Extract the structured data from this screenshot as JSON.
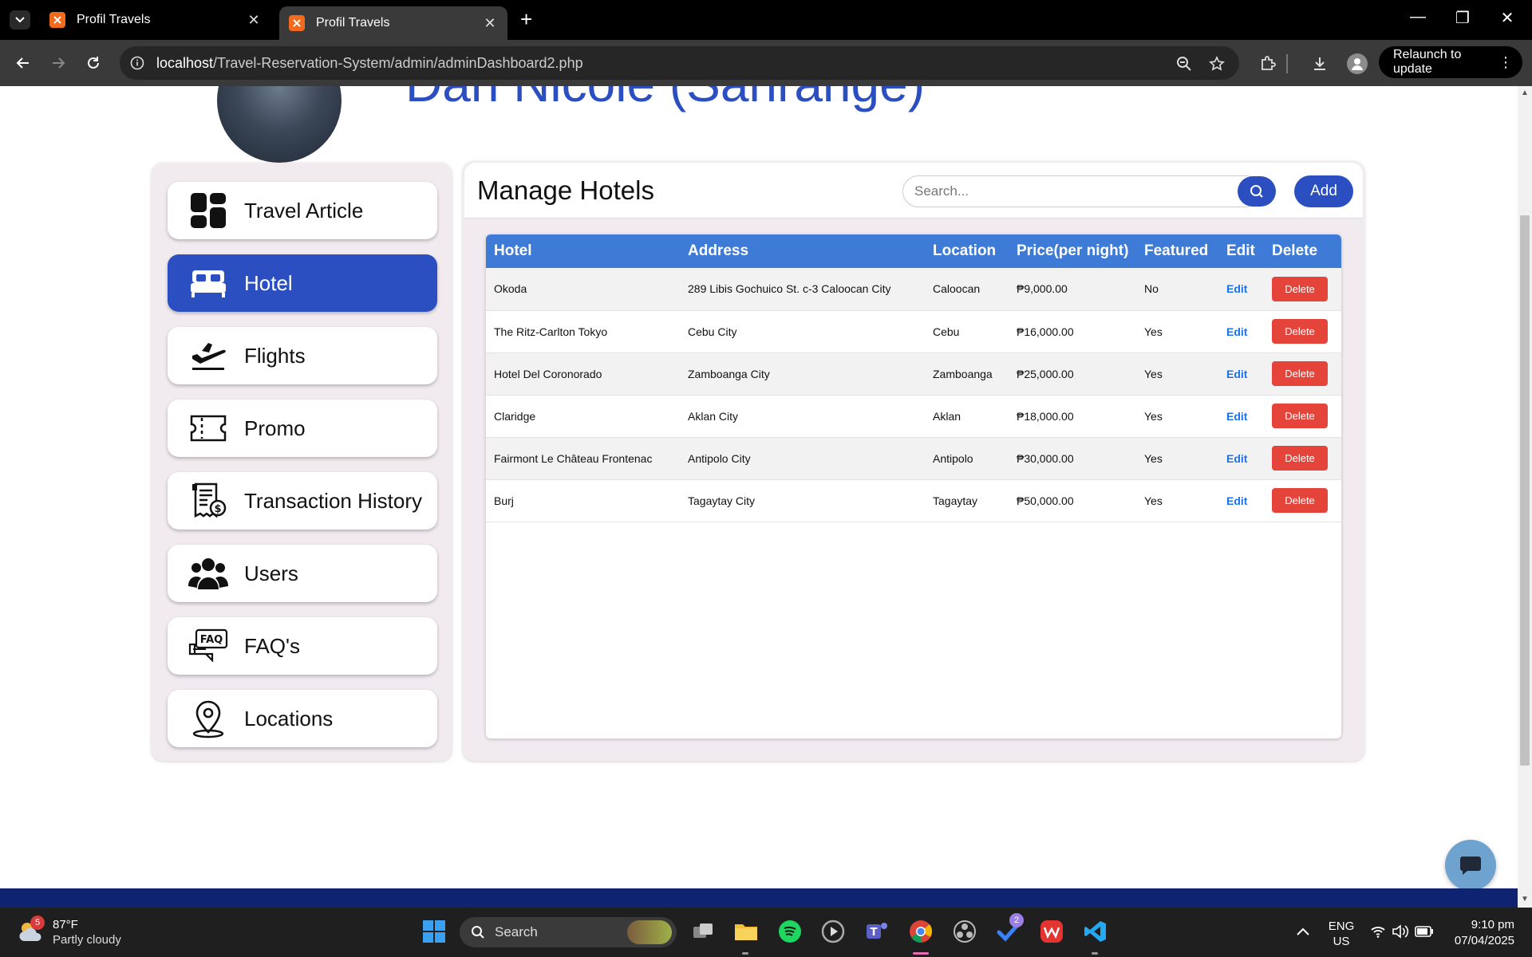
{
  "browser": {
    "tabs": [
      {
        "title": "Profil Travels",
        "active": false
      },
      {
        "title": "Profil Travels",
        "active": true
      }
    ],
    "new_tab_icon": "plus-icon",
    "url_host": "localhost",
    "url_path": "/Travel-Reservation-System/admin/adminDashboard2.php",
    "relaunch_label": "Relaunch to update"
  },
  "profile": {
    "name": "Dan Nicole (Sanrange)"
  },
  "sidebar": {
    "items": [
      {
        "label": "Travel Article",
        "icon": "dashboard-icon",
        "active": false
      },
      {
        "label": "Hotel",
        "icon": "bed-icon",
        "active": true
      },
      {
        "label": "Flights",
        "icon": "plane-departure-icon",
        "active": false
      },
      {
        "label": "Promo",
        "icon": "ticket-icon",
        "active": false
      },
      {
        "label": "Transaction History",
        "icon": "receipt-icon",
        "active": false
      },
      {
        "label": "Users",
        "icon": "users-icon",
        "active": false
      },
      {
        "label": "FAQ's",
        "icon": "faq-icon",
        "active": false
      },
      {
        "label": "Locations",
        "icon": "location-pin-icon",
        "active": false
      }
    ]
  },
  "main": {
    "title": "Manage Hotels",
    "search_placeholder": "Search...",
    "add_label": "Add",
    "columns": [
      "Hotel",
      "Address",
      "Location",
      "Price(per night)",
      "Featured",
      "Edit",
      "Delete"
    ],
    "rows": [
      {
        "hotel": "Okoda",
        "address": "289 Libis Gochuico St. c-3 Caloocan City",
        "location": "Caloocan",
        "price": "₱9,000.00",
        "featured": "No",
        "edit": "Edit",
        "delete": "Delete"
      },
      {
        "hotel": "The Ritz-Carlton Tokyo",
        "address": "Cebu City",
        "location": "Cebu",
        "price": "₱16,000.00",
        "featured": "Yes",
        "edit": "Edit",
        "delete": "Delete"
      },
      {
        "hotel": "Hotel Del Coronorado",
        "address": "Zamboanga City",
        "location": "Zamboanga",
        "price": "₱25,000.00",
        "featured": "Yes",
        "edit": "Edit",
        "delete": "Delete"
      },
      {
        "hotel": "Claridge",
        "address": "Aklan City",
        "location": "Aklan",
        "price": "₱18,000.00",
        "featured": "Yes",
        "edit": "Edit",
        "delete": "Delete"
      },
      {
        "hotel": "Fairmont Le Château Frontenac",
        "address": "Antipolo City",
        "location": "Antipolo",
        "price": "₱30,000.00",
        "featured": "Yes",
        "edit": "Edit",
        "delete": "Delete"
      },
      {
        "hotel": "Burj",
        "address": "Tagaytay City",
        "location": "Tagaytay",
        "price": "₱50,000.00",
        "featured": "Yes",
        "edit": "Edit",
        "delete": "Delete"
      }
    ]
  },
  "taskbar": {
    "weather_temp": "87°F",
    "weather_desc": "Partly cloudy",
    "weather_badge": "5",
    "search_label": "Search",
    "todo_badge": "2",
    "lang_line1": "ENG",
    "lang_line2": "US",
    "time": "9:10 pm",
    "date": "07/04/2025"
  },
  "colors": {
    "brand_blue": "#2b4fc1",
    "table_header": "#3e7bd6",
    "delete_red": "#e5443b",
    "edit_link": "#1a73e8"
  }
}
